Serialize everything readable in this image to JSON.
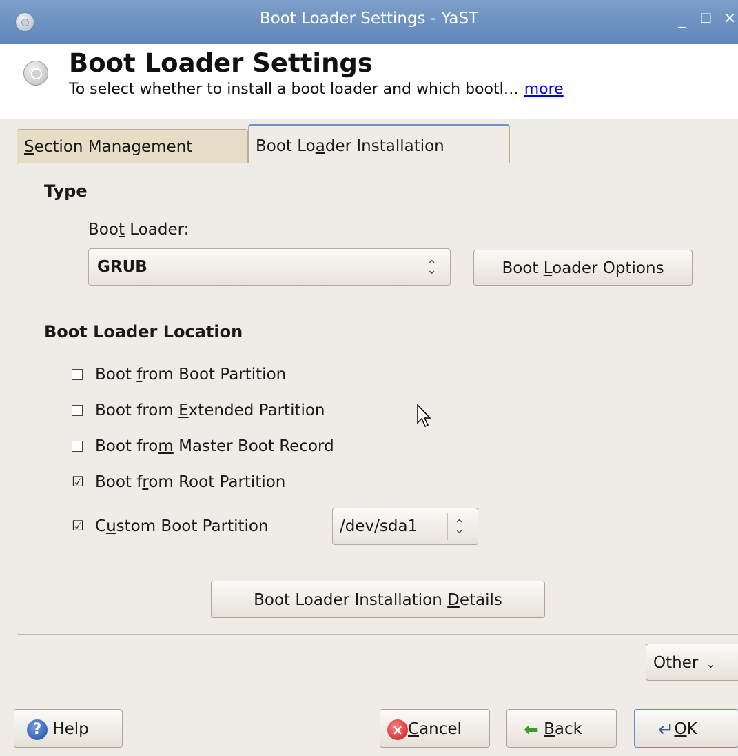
{
  "window": {
    "title": "Boot Loader Settings - YaST",
    "minimize": "_",
    "maximize": "□",
    "close": "×"
  },
  "header": {
    "title": "Boot Loader Settings",
    "description": "To select whether to install a boot loader and which bootl…",
    "more_link": "more"
  },
  "tabs": [
    {
      "label_pre": "",
      "label_u": "S",
      "label_post": "ection Management"
    },
    {
      "label_pre": "Boot Lo",
      "label_u": "a",
      "label_post": "der Installation"
    }
  ],
  "type_section": {
    "heading": "Type",
    "boot_loader_label": {
      "pre": "Boo",
      "u": "t",
      "post": " Loader:"
    },
    "boot_loader_value": "GRUB",
    "options_button": {
      "pre": "Boot ",
      "u": "L",
      "post": "oader Options"
    }
  },
  "location_section": {
    "heading": "Boot Loader Location",
    "options": [
      {
        "pre": "Boot ",
        "u": "f",
        "post": "rom Boot Partition",
        "checked": false
      },
      {
        "pre": "Boot from ",
        "u": "E",
        "post": "xtended Partition",
        "checked": false
      },
      {
        "pre": "Boot fro",
        "u": "m",
        "post": " Master Boot Record",
        "checked": false
      },
      {
        "pre": "Boot f",
        "u": "r",
        "post": "om Root Partition",
        "checked": true
      },
      {
        "pre": "C",
        "u": "u",
        "post": "stom Boot Partition",
        "checked": true
      }
    ],
    "custom_partition_value": "/dev/sda1",
    "details_button": {
      "pre": "Boot Loader Installation ",
      "u": "D",
      "post": "etails"
    }
  },
  "other_button": "Other",
  "footer": {
    "help": "Help",
    "cancel": {
      "u": "C",
      "post": "ancel"
    },
    "back": {
      "u": "B",
      "post": "ack"
    },
    "ok": {
      "u": "O",
      "post": "K"
    }
  },
  "check_mark": "☑",
  "uncheck_mark": "☐"
}
